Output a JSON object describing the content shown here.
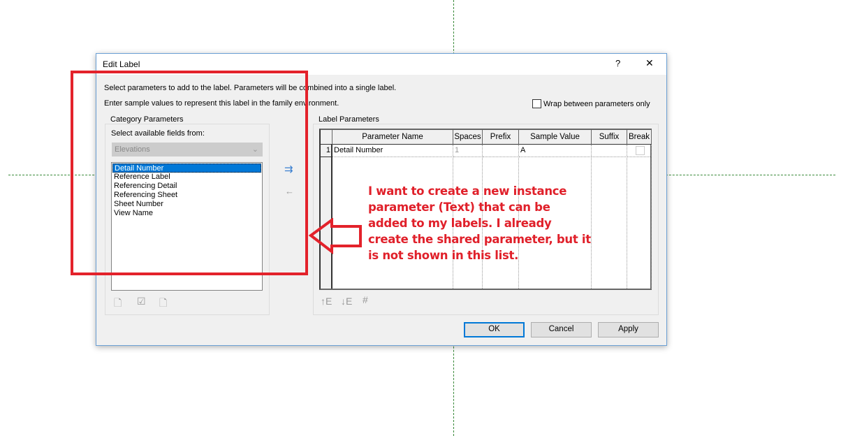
{
  "dialog": {
    "title": "Edit Label",
    "help": "?",
    "close": "✕",
    "instruction1": "Select parameters to add to the label.  Parameters will be combined into a single label.",
    "instruction2": "Enter sample values to represent this label in the family environment.",
    "wrap_label": "Wrap between parameters only",
    "wrap_checked": false
  },
  "category": {
    "legend": "Category Parameters",
    "select_label": "Select available fields from:",
    "selected": "Elevations",
    "items": [
      "Detail Number",
      "Reference Label",
      "Referencing Detail",
      "Referencing Sheet",
      "Sheet Number",
      "View Name"
    ],
    "selected_index": 0
  },
  "label_params": {
    "legend": "Label Parameters",
    "columns": [
      "Parameter Name",
      "Spaces",
      "Prefix",
      "Sample Value",
      "Suffix",
      "Break"
    ],
    "rows": [
      {
        "num": "1",
        "name": "Detail Number",
        "spaces": "1",
        "prefix": "",
        "sample": "A",
        "suffix": "",
        "break": false
      }
    ]
  },
  "buttons": {
    "ok": "OK",
    "cancel": "Cancel",
    "apply": "Apply"
  },
  "annotation": {
    "text": "I want to create a new instance parameter (Text) that can be added to my labels. I already create the shared parameter, but it is not shown in this list.",
    "color": "#e0202a"
  }
}
